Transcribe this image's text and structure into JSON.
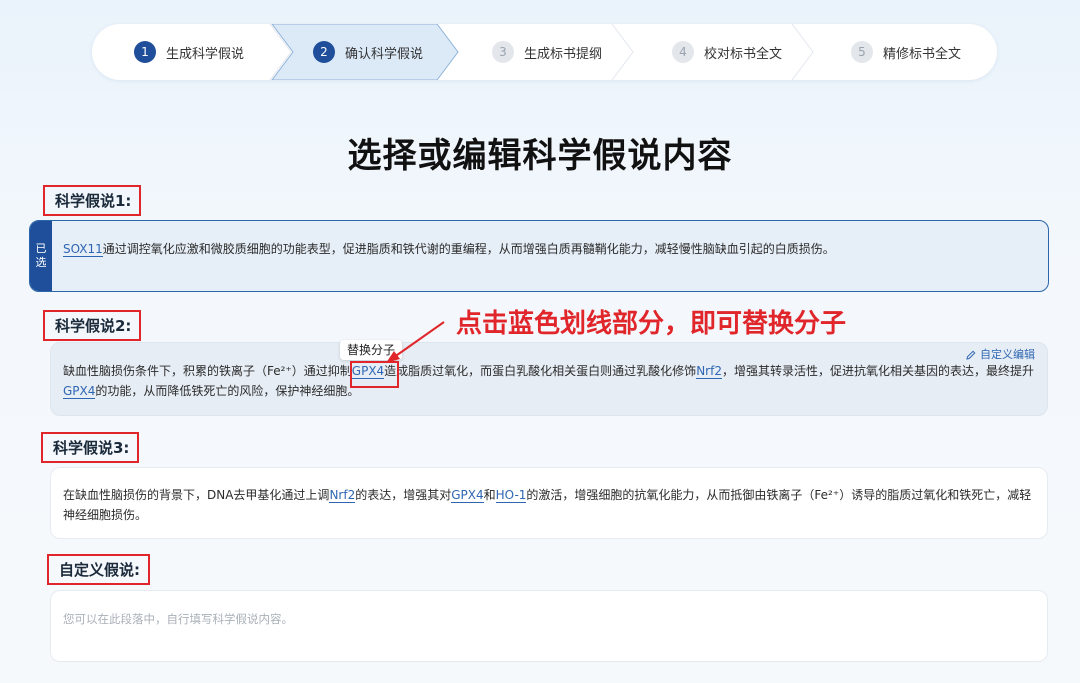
{
  "stepper": {
    "steps": [
      {
        "num": "1",
        "label": "生成科学假说",
        "state": "done"
      },
      {
        "num": "2",
        "label": "确认科学假说",
        "state": "current"
      },
      {
        "num": "3",
        "label": "生成标书提纲",
        "state": "pending"
      },
      {
        "num": "4",
        "label": "校对标书全文",
        "state": "pending"
      },
      {
        "num": "5",
        "label": "精修标书全文",
        "state": "pending"
      }
    ]
  },
  "page_title": "选择或编辑科学假说内容",
  "hypotheses": [
    {
      "label": "科学假说1:",
      "selected_tag": [
        "已",
        "选"
      ],
      "parts": [
        {
          "gene": "SOX11"
        },
        {
          "text": "通过调控氧化应激和微胶质细胞的功能表型，促进脂质和铁代谢的重编程，从而增强白质再髓鞘化能力，减轻慢性脑缺血引起的白质损伤。"
        }
      ]
    },
    {
      "label": "科学假说2:",
      "edit_label": "自定义编辑",
      "tooltip": "替换分子",
      "parts": [
        {
          "text": "缺血性脑损伤条件下，积累的铁离子（Fe²⁺）通过抑制"
        },
        {
          "gene": "GPX4"
        },
        {
          "text": "造成脂质过氧化，而蛋白乳酸化相关蛋白则通过乳酸化修饰"
        },
        {
          "gene": "Nrf2"
        },
        {
          "text": "，增强其转录活性，促进抗氧化相关基因的表达，最终提升"
        },
        {
          "gene": "GPX4"
        },
        {
          "text": "的功能，从而降低铁死亡的风险，保护神经细胞。"
        }
      ]
    },
    {
      "label": "科学假说3:",
      "parts": [
        {
          "text": "在缺血性脑损伤的背景下，DNA去甲基化通过上调"
        },
        {
          "gene": "Nrf2"
        },
        {
          "text": "的表达，增强其对"
        },
        {
          "gene": "GPX4"
        },
        {
          "text": "和"
        },
        {
          "gene": "HO-1"
        },
        {
          "text": "的激活，增强细胞的抗氧化能力，从而抵御由铁离子（Fe²⁺）诱导的脂质过氧化和铁死亡，减轻神经细胞损伤。"
        }
      ]
    }
  ],
  "custom": {
    "label": "自定义假说:",
    "placeholder": "您可以在此段落中，自行填写科学假说内容。"
  },
  "annotation": "点击蓝色划线部分，即可替换分子",
  "colors": {
    "accent": "#1f4f9b",
    "gene_link": "#2f66b3",
    "annotation_red": "#e0262b"
  }
}
